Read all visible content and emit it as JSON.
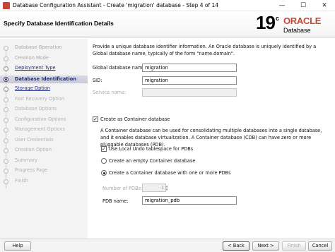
{
  "window": {
    "title": "Database Configuration Assistant - Create 'migration' database - Step 4 of 14",
    "min_glyph": "—",
    "max_glyph": "☐",
    "close_glyph": "✕"
  },
  "header": {
    "page_title": "Specify Database Identification Details",
    "version_number": "19",
    "version_suffix": "c",
    "brand": "ORACLE",
    "product": "Database"
  },
  "steps": [
    {
      "label": "Database Operation",
      "state": "done"
    },
    {
      "label": "Creation Mode",
      "state": "done"
    },
    {
      "label": "Deployment Type",
      "state": "link"
    },
    {
      "label": "Database Identification",
      "state": "current"
    },
    {
      "label": "Storage Option",
      "state": "link"
    },
    {
      "label": "Fast Recovery Option",
      "state": "pending"
    },
    {
      "label": "Database Options",
      "state": "pending"
    },
    {
      "label": "Configuration Options",
      "state": "pending"
    },
    {
      "label": "Management Options",
      "state": "pending"
    },
    {
      "label": "User Credentials",
      "state": "pending"
    },
    {
      "label": "Creation Option",
      "state": "pending"
    },
    {
      "label": "Summary",
      "state": "pending"
    },
    {
      "label": "Progress Page",
      "state": "pending"
    },
    {
      "label": "Finish",
      "state": "pending"
    }
  ],
  "main": {
    "intro": "Provide a unique database identifier information. An Oracle database is uniquely identified by a Global database name, typically of the form \"name.domain\".",
    "global_db_label": "Global database name:",
    "global_db_value": "migration",
    "sid_label": "SID:",
    "sid_value": "migration",
    "service_label": "Service name:",
    "service_value": "",
    "container_checkbox_label": "Create as Container database",
    "container_checked": true,
    "container_desc": "A Container database can be used for consolidating multiple databases into a single database, and it enables database virtualization. A Container database (CDB) can have zero or more pluggable databases (PDB).",
    "undo_label": "Use Local Undo tablespace for PDBs",
    "undo_checked": true,
    "empty_container_label": "Create an empty Container database",
    "one_or_more_label": "Create a Container database with one or more PDBs",
    "selected_option": "one_or_more",
    "num_pdbs_label": "Number of PDBs:",
    "num_pdbs_value": "1",
    "pdb_name_label": "PDB name:",
    "pdb_name_value": "migration_pdb"
  },
  "footer": {
    "help": "Help",
    "back": "< Back",
    "next": "Next >",
    "finish": "Finish",
    "cancel": "Cancel"
  }
}
